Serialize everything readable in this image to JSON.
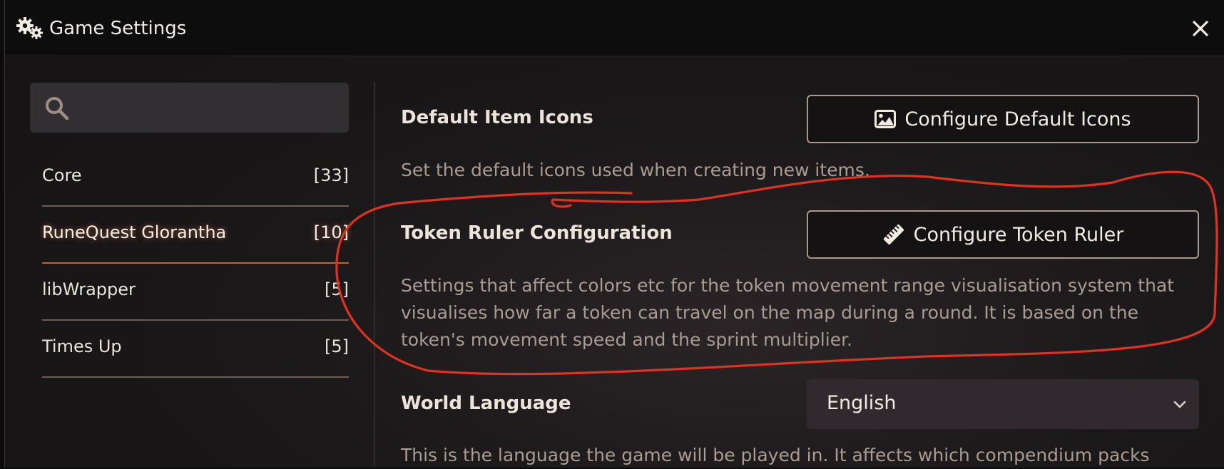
{
  "window": {
    "title": "Game Settings",
    "title_icon": "gears-icon",
    "close_icon": "close-icon"
  },
  "sidebar": {
    "search": {
      "placeholder": "",
      "value": "",
      "icon": "search-icon"
    },
    "categories": [
      {
        "label": "Core",
        "count": "[33]",
        "active": false
      },
      {
        "label": "RuneQuest Glorantha",
        "count": "[10]",
        "active": true
      },
      {
        "label": "libWrapper",
        "count": "[5]",
        "active": false
      },
      {
        "label": "Times Up",
        "count": "[5]",
        "active": false
      }
    ]
  },
  "settings": {
    "default_icons": {
      "label": "Default Item Icons",
      "button_label": "Configure Default Icons",
      "button_icon": "image-icon",
      "hint": "Set the default icons used when creating new items."
    },
    "token_ruler": {
      "label": "Token Ruler Configuration",
      "button_label": "Configure Token Ruler",
      "button_icon": "ruler-icon",
      "hint": "Settings that affect colors etc for the token movement range visualisation system that visualises how far a token can travel on the map during a round. It is based on the token's movement speed and the sprint multiplier."
    },
    "world_language": {
      "label": "World Language",
      "selected": "English",
      "hint": "This is the language the game will be played in. It affects which compendium packs"
    }
  },
  "colors": {
    "annotation_red": "#e0331f",
    "active_tab_underline": "#b9653f",
    "text_primary": "#ece4da",
    "text_hint": "#a89c93"
  }
}
